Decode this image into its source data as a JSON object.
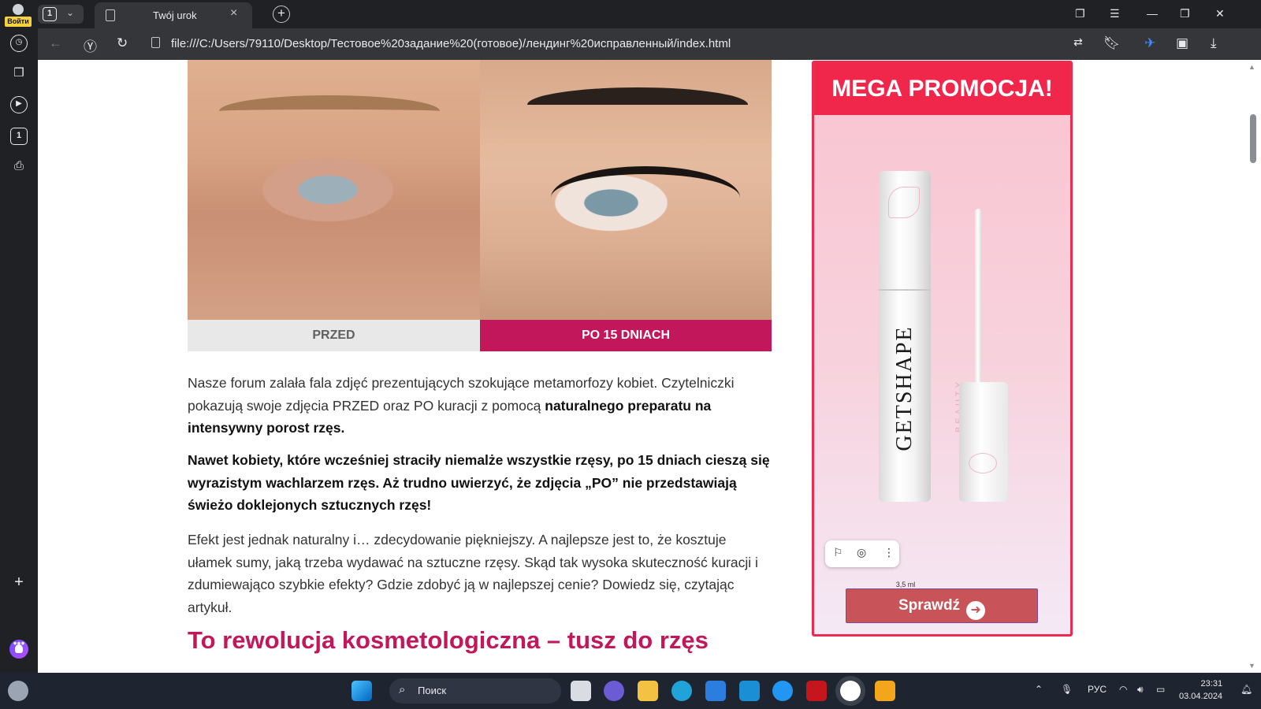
{
  "browser": {
    "profile_label": "Войти",
    "tab_count": "1",
    "tab_title": "Twój urok",
    "url": "file:///C:/Users/79110/Desktop/Тестовое%20задание%20(готовое)/лендинг%20исправленный/index.html"
  },
  "sidebar": {
    "tab_number": "1"
  },
  "article": {
    "caption_before": "PRZED",
    "caption_after": "PO 15 DNIACH",
    "p1_text": "Nasze forum zalała fala zdjęć prezentujących szokujące metamorfozy kobiet. Czytelniczki pokazują swoje zdjęcia PRZED oraz PO kuracji z pomocą ",
    "p1_bold": "naturalnego preparatu na intensywny porost rzęs.",
    "p2": "Nawet kobiety, które wcześniej straciły niemalże wszystkie rzęsy, po 15 dniach cieszą się wyrazistym wachlarzem rzęs. Aż trudno uwierzyć, że zdjęcia „PO” nie przedstawiają świeżo doklejonych sztucznych rzęs!",
    "p3": "Efekt jest jednak naturalny i… zdecydowanie piękniejszy. A najlepsze jest to, że kosztuje ułamek sumy, jaką trzeba wydawać na sztuczne rzęsy. Skąd tak wysoka skuteczność kuracji i zdumiewająco szybkie efekty? Gdzie zdobyć ją w najlepszej cenie? Dowiedz się, czytając artykuł.",
    "heading": "To rewolucja kosmetologiczna – tusz do rzęs"
  },
  "ad": {
    "headline": "MEGA PROMOCJA!",
    "brand": "GETSHAPE",
    "brand_sub": "BEAUTY EYES",
    "volume": "3,5 ml\n0.12 fl.oz.",
    "button_label": "Sprawdź"
  },
  "taskbar": {
    "search_label": "Поиск",
    "language": "РУС",
    "time": "23:31",
    "date": "03.04.2024"
  },
  "colors": {
    "accent": "#c2185b",
    "ad_red": "#f0264b",
    "button": "#c8545a"
  }
}
